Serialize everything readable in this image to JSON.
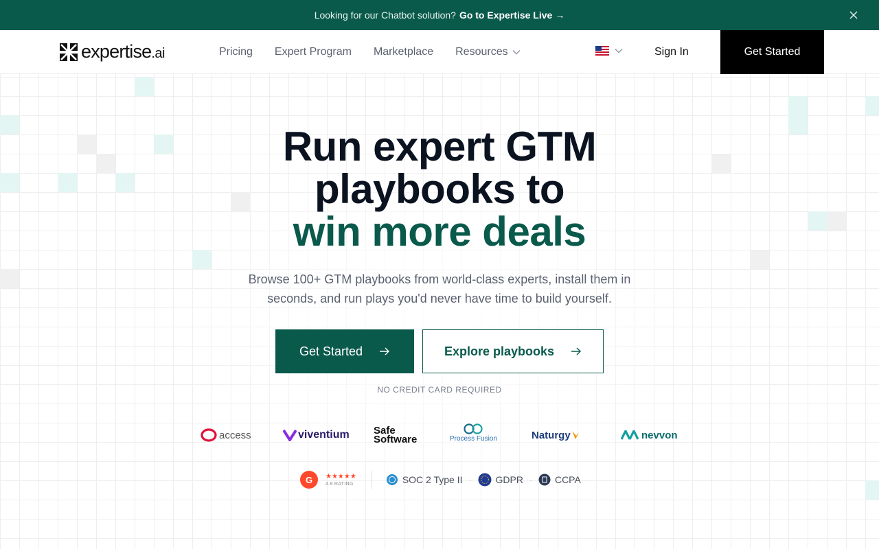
{
  "announcement": {
    "text": "Looking for our Chatbot solution?",
    "link": "Go to Expertise Live",
    "arrow": "→"
  },
  "header": {
    "logo_word": "expertise",
    "logo_tld": ".ai",
    "nav": [
      {
        "label": "Pricing"
      },
      {
        "label": "Expert Program"
      },
      {
        "label": "Marketplace"
      },
      {
        "label": "Resources"
      }
    ],
    "sign_in": "Sign In",
    "cta": "Get Started"
  },
  "hero": {
    "title_line1": "Run expert GTM",
    "title_line2": "playbooks to",
    "title_accent": "win more deals",
    "subtitle": "Browse 100+ GTM playbooks from world-class experts, install them in seconds, and run plays you'd never have time to build yourself.",
    "primary_button": "Get Started",
    "secondary_button": "Explore playbooks",
    "note": "NO CREDIT CARD REQUIRED"
  },
  "logos": {
    "access": "access",
    "viventium": "viventium",
    "safe_line1": "Safe",
    "safe_line2": "Software",
    "processfusion": "Process Fusion",
    "naturgy": "Naturgy",
    "nevvon": "nevvon"
  },
  "trust": {
    "g2_stars": "★★★★★",
    "g2_rating": "4.9 RATING",
    "soc2": "SOC 2 Type II",
    "gdpr": "GDPR",
    "ccpa": "CCPA"
  },
  "colors": {
    "brand": "#0a5a4c",
    "cta_black": "#000000",
    "g2_red": "#ff492c"
  }
}
